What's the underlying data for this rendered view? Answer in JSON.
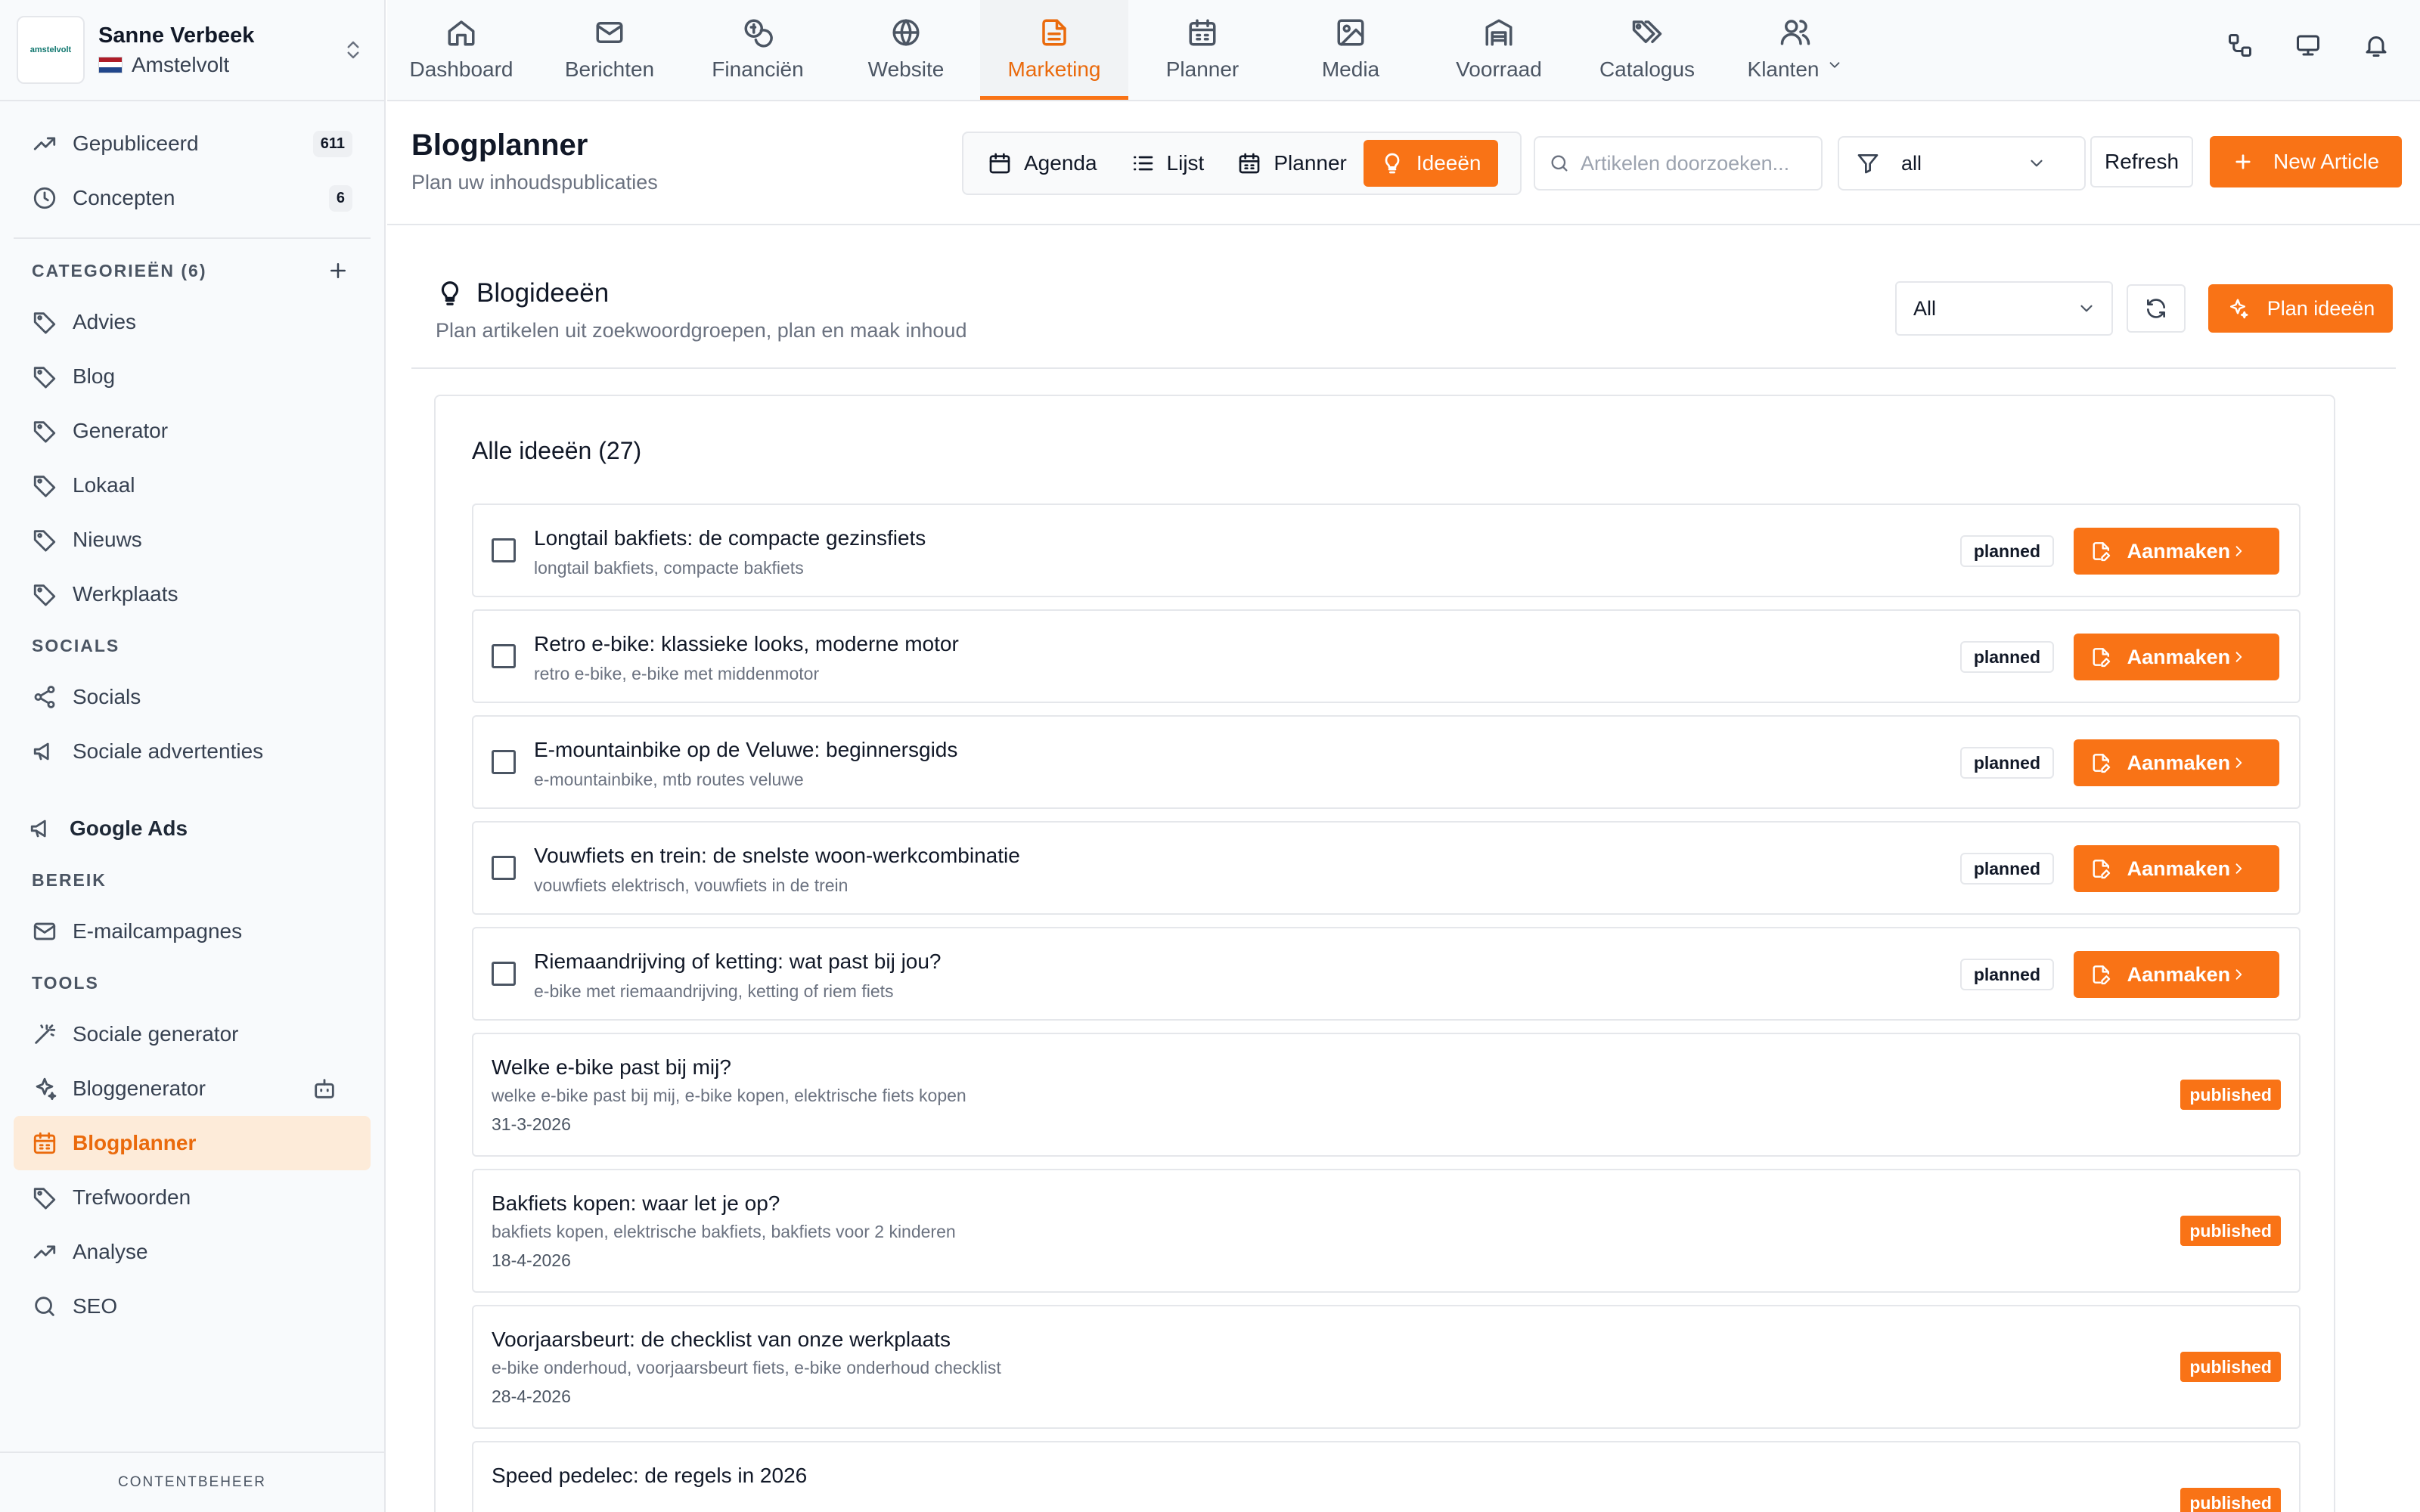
{
  "account": {
    "logo_text": "amstelvolt",
    "name": "Sanne Verbeek",
    "org": "Amstelvolt"
  },
  "sidebar": {
    "top_items": [
      {
        "label": "Gepubliceerd",
        "count": "611",
        "icon": "trending-up-icon"
      },
      {
        "label": "Concepten",
        "count": "6",
        "icon": "clock-icon"
      }
    ],
    "categories_label": "CATEGORIEËN (6)",
    "categories": [
      "Advies",
      "Blog",
      "Generator",
      "Lokaal",
      "Nieuws",
      "Werkplaats"
    ],
    "socials_label": "SOCIALS",
    "socials": [
      "Socials",
      "Sociale advertenties"
    ],
    "google_ads": "Google Ads",
    "reach_label": "BEREIK",
    "reach": [
      "E-mailcampagnes"
    ],
    "tools_label": "TOOLS",
    "tools": [
      "Sociale generator",
      "Bloggenerator",
      "Blogplanner",
      "Trefwoorden",
      "Analyse",
      "SEO"
    ],
    "active": "Blogplanner",
    "footer": "CONTENTBEHEER"
  },
  "topnav": {
    "tabs": [
      {
        "label": "Dashboard",
        "icon": "home-icon"
      },
      {
        "label": "Berichten",
        "icon": "mail-icon"
      },
      {
        "label": "Financiën",
        "icon": "coins-icon"
      },
      {
        "label": "Website",
        "icon": "globe-icon"
      },
      {
        "label": "Marketing",
        "icon": "file-text-icon"
      },
      {
        "label": "Planner",
        "icon": "calendar-icon"
      },
      {
        "label": "Media",
        "icon": "image-icon"
      },
      {
        "label": "Voorraad",
        "icon": "warehouse-icon"
      },
      {
        "label": "Catalogus",
        "icon": "tags-icon"
      },
      {
        "label": "Klanten",
        "icon": "users-icon"
      }
    ],
    "active": "Marketing"
  },
  "header": {
    "title": "Blogplanner",
    "subtitle": "Plan uw inhoudspublicaties",
    "views": [
      "Agenda",
      "Lijst",
      "Planner",
      "Ideeën"
    ],
    "active_view": "Ideeën",
    "search_placeholder": "Artikelen doorzoeken...",
    "filter_value": "all",
    "refresh_label": "Refresh",
    "new_article_label": "New Article"
  },
  "ideas": {
    "title": "Blogideeën",
    "subtitle": "Plan artikelen uit zoekwoordgroepen, plan en maak inhoud",
    "filter_value": "All",
    "plan_label": "Plan ideeën",
    "list_title": "Alle ideeën (27)",
    "create_label": "Aanmaken",
    "items": [
      {
        "title": "Longtail bakfiets: de compacte gezinsfiets",
        "keywords": "longtail bakfiets, compacte bakfiets",
        "status": "planned"
      },
      {
        "title": "Retro e-bike: klassieke looks, moderne motor",
        "keywords": "retro e-bike, e-bike met middenmotor",
        "status": "planned"
      },
      {
        "title": "E-mountainbike op de Veluwe: beginnersgids",
        "keywords": "e-mountainbike, mtb routes veluwe",
        "status": "planned"
      },
      {
        "title": "Vouwfiets en trein: de snelste woon-werkcombinatie",
        "keywords": "vouwfiets elektrisch, vouwfiets in de trein",
        "status": "planned"
      },
      {
        "title": "Riemaandrijving of ketting: wat past bij jou?",
        "keywords": "e-bike met riemaandrijving, ketting of riem fiets",
        "status": "planned"
      },
      {
        "title": "Welke e-bike past bij mij?",
        "keywords": "welke e-bike past bij mij, e-bike kopen, elektrische fiets kopen",
        "date": "31-3-2026",
        "status": "published"
      },
      {
        "title": "Bakfiets kopen: waar let je op?",
        "keywords": "bakfiets kopen, elektrische bakfiets, bakfiets voor 2 kinderen",
        "date": "18-4-2026",
        "status": "published"
      },
      {
        "title": "Voorjaarsbeurt: de checklist van onze werkplaats",
        "keywords": "e-bike onderhoud, voorjaarsbeurt fiets, e-bike onderhoud checklist",
        "date": "28-4-2026",
        "status": "published"
      },
      {
        "title": "Speed pedelec: de regels in 2026",
        "keywords": "",
        "date": "",
        "status": "published"
      }
    ]
  },
  "colors": {
    "accent": "#f97316",
    "accent_text": "#ea6a0c",
    "active_bg": "#fdebd9"
  }
}
